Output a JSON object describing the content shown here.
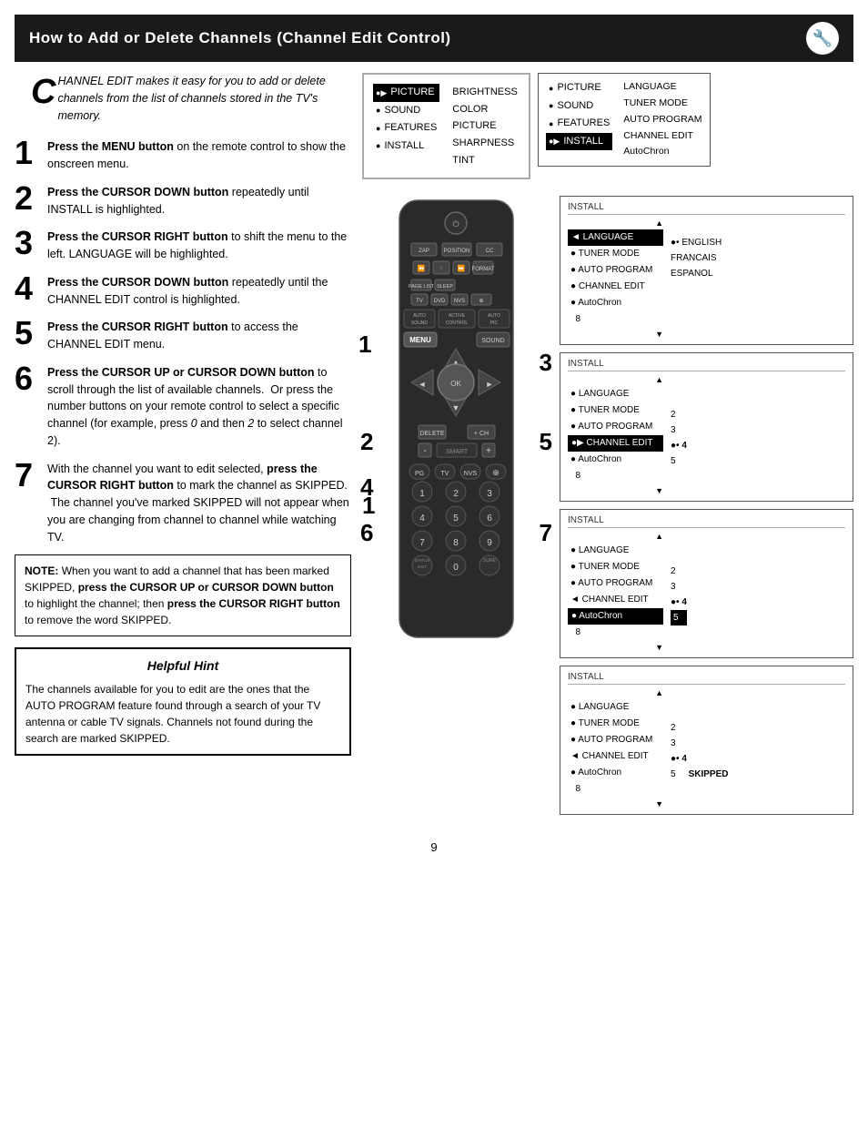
{
  "header": {
    "title": "How to Add or Delete Channels (Channel Edit Control)",
    "icon": "🔧"
  },
  "intro": {
    "drop_cap": "C",
    "text": "HANNEL EDIT makes it easy for you to add or delete channels from the list of channels stored in the TV's memory."
  },
  "steps": [
    {
      "number": "1",
      "text_bold": "Press the MENU button",
      "text_rest": " on the remote control to show the onscreen menu."
    },
    {
      "number": "2",
      "text_bold": "Press the CURSOR DOWN button",
      "text_rest": " repeatedly until INSTALL is highlighted."
    },
    {
      "number": "3",
      "text_bold": "Press the CURSOR RIGHT button",
      "text_rest": " to shift the menu to the left. LANGUAGE will be highlighted."
    },
    {
      "number": "4",
      "text_bold": "Press the CURSOR DOWN button",
      "text_rest": " repeatedly until the CHANNEL EDIT control is highlighted."
    },
    {
      "number": "5",
      "text_bold": "Press the CURSOR RIGHT button",
      "text_rest": " to access the CHANNEL EDIT menu."
    },
    {
      "number": "6",
      "text_bold": "Press the CURSOR UP or CURSOR DOWN button",
      "text_rest": " to scroll through the list of available channels.  Or press the number buttons on your remote control to select a specific channel (for example, press 0 and then 2 to select channel 2)."
    },
    {
      "number": "7",
      "text_rest": "With the channel you want to edit selected, ",
      "text_bold2": "press the CURSOR RIGHT button",
      "text_rest2": " to mark the channel as SKIPPED.  The channel you've marked SKIPPED will not appear when you are changing from channel to channel while watching TV."
    }
  ],
  "note": {
    "label": "NOTE:",
    "text": " When you want to add a channel that has been marked SKIPPED, press the CURSOR UP or CURSOR DOWN button to highlight the channel; then press the CURSOR RIGHT button to remove the word SKIPPED."
  },
  "helpful_hint": {
    "title": "Helpful Hint",
    "text": "The channels available for you to edit are the ones that the AUTO PROGRAM feature found through a search of your TV antenna or cable TV signals. Channels not found during the search are marked SKIPPED."
  },
  "menu_screen1": {
    "items_left": [
      {
        "label": "PICTURE",
        "highlighted": true,
        "bullet": "●▶"
      },
      {
        "label": "SOUND",
        "bullet": "●"
      },
      {
        "label": "FEATURES",
        "bullet": "●"
      },
      {
        "label": "INSTALL",
        "bullet": "●"
      }
    ],
    "items_right": [
      "BRIGHTNESS",
      "COLOR",
      "PICTURE",
      "SHARPNESS",
      "TINT"
    ]
  },
  "menu_screen2": {
    "title": "install_highlight",
    "items_left": [
      {
        "label": "PICTURE",
        "bullet": "●"
      },
      {
        "label": "SOUND",
        "bullet": "●"
      },
      {
        "label": "FEATURES",
        "bullet": "●"
      },
      {
        "label": "INSTALL",
        "highlighted": true,
        "bullet": "●▶"
      }
    ],
    "items_right": [
      "LANGUAGE",
      "TUNER MODE",
      "AUTO PROGRAM",
      "CHANNEL EDIT",
      "AutoChron"
    ]
  },
  "menu_screen3": {
    "title": "INSTALL",
    "up_arrow": "▲",
    "down_arrow": "▼",
    "items_left": [
      {
        "label": "LANGUAGE",
        "highlighted": true,
        "bullet": "◄"
      },
      {
        "label": "TUNER MODE",
        "bullet": "●"
      },
      {
        "label": "AUTO PROGRAM",
        "bullet": "●"
      },
      {
        "label": "CHANNEL EDIT",
        "bullet": "●"
      },
      {
        "label": "AutoChron",
        "bullet": "●"
      },
      {
        "label": "8"
      }
    ],
    "items_right": [
      "●• ENGLISH",
      "FRANCAIS",
      "ESPANOL"
    ]
  },
  "menu_screen4": {
    "title": "INSTALL",
    "up_arrow": "▲",
    "down_arrow": "▼",
    "items_left": [
      {
        "label": "LANGUAGE",
        "bullet": "●"
      },
      {
        "label": "TUNER MODE",
        "bullet": "●"
      },
      {
        "label": "AUTO PROGRAM",
        "bullet": "●"
      },
      {
        "label": "CHANNEL EDIT",
        "highlighted": true,
        "bullet": "●▶"
      },
      {
        "label": "AutoChron",
        "bullet": "●"
      },
      {
        "label": "8"
      }
    ],
    "items_right": [
      "",
      "2",
      "3",
      "●• 4",
      "5",
      ""
    ]
  },
  "menu_screen5": {
    "title": "INSTALL",
    "up_arrow": "▲",
    "down_arrow": "▼",
    "items_left": [
      {
        "label": "LANGUAGE",
        "bullet": "●"
      },
      {
        "label": "TUNER MODE",
        "bullet": "●"
      },
      {
        "label": "AUTO PROGRAM",
        "bullet": "●"
      },
      {
        "label": "CHANNEL EDIT",
        "bullet": "◄"
      },
      {
        "label": "AutoChron",
        "bullet": "●"
      },
      {
        "label": "8"
      }
    ],
    "items_right": [
      "",
      "2",
      "3",
      "●• 4",
      "5",
      ""
    ],
    "highlighted_row": 4
  },
  "menu_screen6": {
    "title": "INSTALL",
    "up_arrow": "▲",
    "down_arrow": "▼",
    "items_left": [
      {
        "label": "LANGUAGE",
        "bullet": "●"
      },
      {
        "label": "TUNER MODE",
        "bullet": "●"
      },
      {
        "label": "AUTO PROGRAM",
        "bullet": "●"
      },
      {
        "label": "CHANNEL EDIT",
        "bullet": "◄"
      },
      {
        "label": "AutoChron",
        "bullet": "●"
      },
      {
        "label": "8"
      }
    ],
    "items_right": [
      "",
      "2",
      "3",
      "●• 4",
      "5",
      ""
    ],
    "skipped_label": "SKIPPED",
    "highlighted_row": 4
  },
  "page_number": "9"
}
